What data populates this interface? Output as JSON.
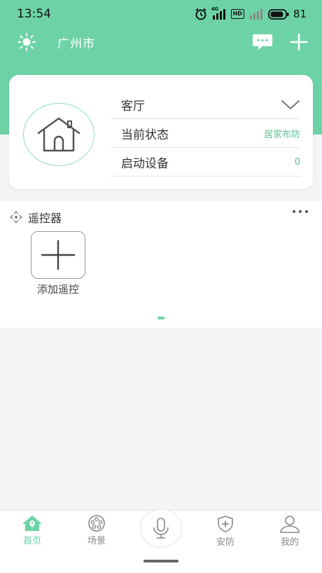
{
  "status_bar": {
    "time": "13:54",
    "signal_label": "4G",
    "hd_label": "HD",
    "battery": "81"
  },
  "header": {
    "city": "广州市",
    "weather_icon": "sun-icon",
    "message_icon": "message-icon",
    "add_icon": "plus-icon",
    "background_color": "#6dd3a6"
  },
  "room_card": {
    "room_name": "客厅",
    "status_label": "当前状态",
    "status_value": "居家布防",
    "devices_label": "启动设备",
    "devices_value": "0",
    "accent_color": "#5fbf95"
  },
  "remote_section": {
    "title": "遥控器",
    "add_label": "添加遥控"
  },
  "tabs": [
    {
      "label": "首页",
      "icon": "home-icon",
      "active": true
    },
    {
      "label": "场景",
      "icon": "scene-icon",
      "active": false
    },
    {
      "label": "",
      "icon": "microphone-icon",
      "active": false
    },
    {
      "label": "安防",
      "icon": "shield-plus-icon",
      "active": false
    },
    {
      "label": "我的",
      "icon": "user-icon",
      "active": false
    }
  ]
}
